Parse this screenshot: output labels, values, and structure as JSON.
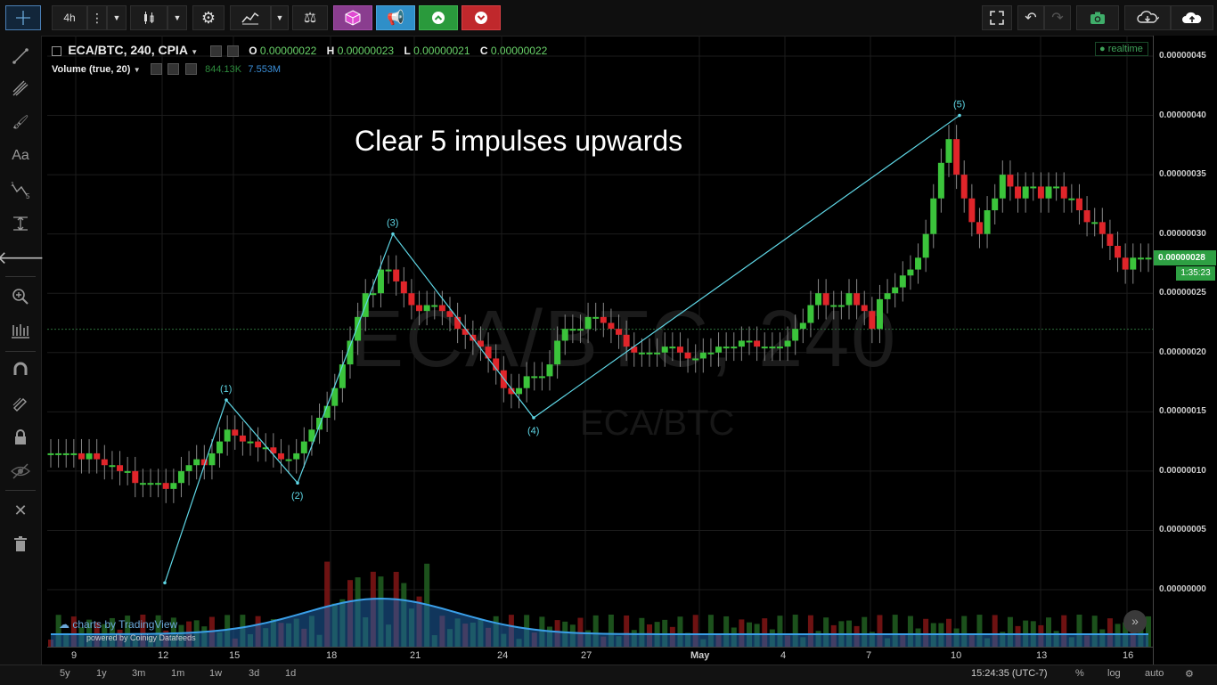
{
  "toolbar": {
    "interval": "4h",
    "colors": {
      "purple": "#8a3d8f",
      "blue": "#2f8fc8",
      "green": "#2a9a3c",
      "red": "#c0282c"
    }
  },
  "legend": {
    "symbol": "ECA/BTC, 240, CPIA",
    "o_key": "O",
    "o_val": "0.00000022",
    "h_key": "H",
    "h_val": "0.00000023",
    "l_key": "L",
    "l_val": "0.00000021",
    "c_key": "C",
    "c_val": "0.00000022",
    "volume_title": "Volume (true, 20)",
    "volume_val1": "844.13K",
    "volume_val2": "7.553M"
  },
  "realtime_label": "realtime",
  "annotation": "Clear 5 impulses upwards",
  "watermark": "ECA/BTC, 240",
  "watermark_sub": "ECA/BTC",
  "waves": [
    {
      "label": "(1)",
      "price": 1.6e-07
    },
    {
      "label": "(2)",
      "price": 9e-08
    },
    {
      "label": "(3)",
      "price": 3e-07
    },
    {
      "label": "(4)",
      "price": 1.45e-07
    },
    {
      "label": "(5)",
      "price": 4e-07
    }
  ],
  "price_axis": [
    "0.00000045",
    "0.00000040",
    "0.00000035",
    "0.00000030",
    "0.00000025",
    "0.00000020",
    "0.00000015",
    "0.00000010",
    "0.00000005",
    "0.00000000"
  ],
  "current_price": "0.00000028",
  "countdown": "1:35:23",
  "time_axis": [
    "9",
    "12",
    "15",
    "18",
    "21",
    "24",
    "27",
    "May",
    "4",
    "7",
    "10",
    "13",
    "16"
  ],
  "bottom": {
    "ranges": [
      "5y",
      "1y",
      "3m",
      "1m",
      "1w",
      "3d",
      "1d"
    ],
    "clock": "15:24:35 (UTC-7)",
    "pct": "%",
    "log": "log",
    "auto": "auto"
  },
  "branding": {
    "line1": "charts by TradingView",
    "line2": "powered by Coinigy Datafeeds"
  },
  "chart_data": {
    "type": "candlestick",
    "series": [
      {
        "name": "ECA/BTC, 240, CPIA",
        "values": [
          1.15e-07,
          1.15e-07,
          1.15e-07,
          1.15e-07,
          1.1e-07,
          1.15e-07,
          1.1e-07,
          1.05e-07,
          1.05e-07,
          1e-07,
          1e-07,
          9e-08,
          9e-08,
          9e-08,
          9e-08,
          8.5e-08,
          9e-08,
          1e-07,
          1.05e-07,
          1.1e-07,
          1.05e-07,
          1.15e-07,
          1.25e-07,
          1.35e-07,
          1.3e-07,
          1.25e-07,
          1.25e-07,
          1.2e-07,
          1.2e-07,
          1.15e-07,
          1.1e-07,
          1.1e-07,
          1.15e-07,
          1.25e-07,
          1.35e-07,
          1.45e-07,
          1.55e-07,
          1.7e-07,
          1.9e-07,
          2.1e-07,
          2.3e-07,
          2.5e-07,
          2.5e-07,
          2.7e-07,
          2.7e-07,
          2.6e-07,
          2.5e-07,
          2.4e-07,
          2.35e-07,
          2.4e-07,
          2.4e-07,
          2.35e-07,
          2.3e-07,
          2.2e-07,
          2.15e-07,
          2.1e-07,
          2.05e-07,
          1.95e-07,
          1.85e-07,
          1.7e-07,
          1.65e-07,
          1.7e-07,
          1.8e-07,
          1.8e-07,
          1.8e-07,
          1.9e-07,
          2.1e-07,
          2.2e-07,
          2.2e-07,
          2.2e-07,
          2.3e-07,
          2.3e-07,
          2.25e-07,
          2.2e-07,
          2.15e-07,
          2.05e-07,
          2e-07,
          2e-07,
          2e-07,
          2e-07,
          2.05e-07,
          2.05e-07,
          2e-07,
          1.95e-07,
          1.95e-07,
          2e-07,
          2e-07,
          2.05e-07,
          2.05e-07,
          2.05e-07,
          2.1e-07,
          2.1e-07,
          2.05e-07,
          2.05e-07,
          2.05e-07,
          2.05e-07,
          2.1e-07,
          2.2e-07,
          2.25e-07,
          2.4e-07,
          2.5e-07,
          2.4e-07,
          2.4e-07,
          2.4e-07,
          2.5e-07,
          2.4e-07,
          2.35e-07,
          2.2e-07,
          2.45e-07,
          2.5e-07,
          2.55e-07,
          2.65e-07,
          2.7e-07,
          2.8e-07,
          3e-07,
          3.3e-07,
          3.6e-07,
          3.8e-07,
          3.5e-07,
          3.3e-07,
          3.1e-07,
          3e-07,
          3.2e-07,
          3.3e-07,
          3.5e-07,
          3.4e-07,
          3.3e-07,
          3.4e-07,
          3.4e-07,
          3.3e-07,
          3.4e-07,
          3.4e-07,
          3.3e-07,
          3.3e-07,
          3.2e-07,
          3.1e-07,
          3.1e-07,
          3e-07,
          2.9e-07,
          2.8e-07,
          2.7e-07,
          2.8e-07,
          2.8e-07,
          2.8e-07
        ]
      }
    ],
    "ylim": [
      -5e-08,
      4.7e-07
    ],
    "grid": true,
    "log_scale": false
  }
}
